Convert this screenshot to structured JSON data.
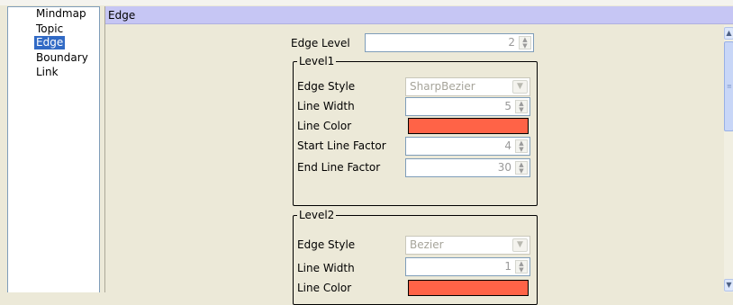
{
  "nav": {
    "items": [
      {
        "label": "Mindmap",
        "selected": false
      },
      {
        "label": "Topic",
        "selected": false
      },
      {
        "label": "Edge",
        "selected": true
      },
      {
        "label": "Boundary",
        "selected": false
      },
      {
        "label": "Link",
        "selected": false
      }
    ]
  },
  "panel": {
    "title": "Edge",
    "edge_level": {
      "label": "Edge Level",
      "value": "2"
    },
    "levels": [
      {
        "title": "Level1",
        "edge_style": {
          "label": "Edge Style",
          "value": "SharpBezier"
        },
        "line_width": {
          "label": "Line Width",
          "value": "5"
        },
        "line_color": {
          "label": "Line Color",
          "value": "#ff6347"
        },
        "start_line_factor": {
          "label": "Start Line Factor",
          "value": "4"
        },
        "end_line_factor": {
          "label": "End Line Factor",
          "value": "30"
        }
      },
      {
        "title": "Level2",
        "edge_style": {
          "label": "Edge Style",
          "value": "Bezier"
        },
        "line_width": {
          "label": "Line Width",
          "value": "1"
        },
        "line_color": {
          "label": "Line Color",
          "value": "#ff6347"
        }
      }
    ]
  },
  "icons": {
    "spin_up": "▲",
    "spin_down": "▼",
    "dropdown": "▼",
    "scroll_up": "▲",
    "scroll_down": "▼",
    "scroll_grip": "≡"
  }
}
